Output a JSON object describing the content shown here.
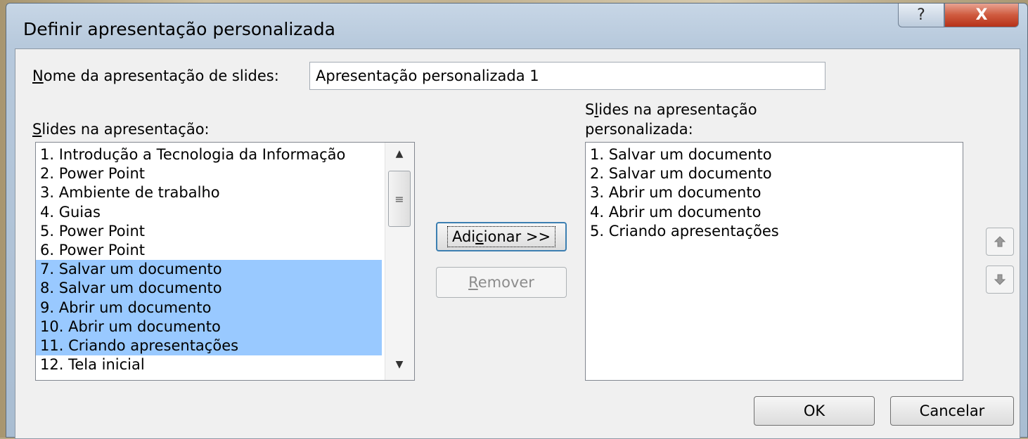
{
  "window": {
    "title": "Definir apresentação personalizada",
    "help_glyph": "?",
    "close_glyph": "X"
  },
  "name_field": {
    "label_mnemonic": "N",
    "label_rest": "ome da apresentação de slides:",
    "value": "Apresentação personalizada 1"
  },
  "left_panel": {
    "label_mnemonic": "S",
    "label_rest": "lides na apresentação:",
    "items": [
      {
        "text": "1. Introdução a Tecnologia da Informação",
        "selected": false
      },
      {
        "text": "2. Power Point",
        "selected": false
      },
      {
        "text": "3. Ambiente de trabalho",
        "selected": false
      },
      {
        "text": "4. Guias",
        "selected": false
      },
      {
        "text": "5. Power Point",
        "selected": false
      },
      {
        "text": "6. Power Point",
        "selected": false
      },
      {
        "text": "7. Salvar um documento",
        "selected": true
      },
      {
        "text": "8. Salvar um documento",
        "selected": true
      },
      {
        "text": "9. Abrir um documento",
        "selected": true
      },
      {
        "text": "10. Abrir um documento",
        "selected": true
      },
      {
        "text": "11. Criando apresentações",
        "selected": true
      },
      {
        "text": "12. Tela inicial",
        "selected": false
      }
    ]
  },
  "right_panel": {
    "label_line1_pre": "S",
    "label_line1_mnemonic": "l",
    "label_line1_post": "ides na apresentação",
    "label_line2": "personalizada:",
    "items": [
      "1. Salvar um documento",
      "2. Salvar um documento",
      "3. Abrir um documento",
      "4. Abrir um documento",
      "5. Criando apresentações"
    ]
  },
  "buttons": {
    "add_pre": "Adi",
    "add_mnemonic": "c",
    "add_post": "ionar >>",
    "remove_mnemonic": "R",
    "remove_rest": "emover",
    "ok": "OK",
    "cancel": "Cancelar"
  },
  "icons": {
    "help": "help-icon",
    "close": "close-icon",
    "move_up": "arrow-up-icon",
    "move_down": "arrow-down-icon",
    "scroll_up": "scroll-up-arrow-icon",
    "scroll_down": "scroll-down-arrow-icon",
    "scroll_grip": "scroll-grip-icon"
  },
  "colors": {
    "selection": "#99c9ff",
    "close_button": "#c8442b",
    "title_bar": "#b9cbde"
  }
}
